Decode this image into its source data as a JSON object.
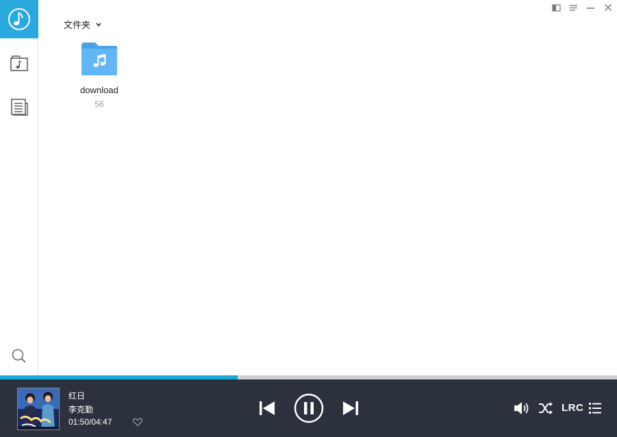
{
  "colors": {
    "accent": "#2aa9e0",
    "progress": "#1ba9d9",
    "player_bg": "#2c323d",
    "folder": "#5fb3f2"
  },
  "header": {
    "folder_dropdown_label": "文件夹"
  },
  "folders": [
    {
      "name": "download",
      "count": "56",
      "icon": "music-folder-icon"
    }
  ],
  "player": {
    "title": "红日",
    "artist": "李克勤",
    "time": "01:50/04:47",
    "progress": 0.385,
    "lrc_label": "LRC"
  }
}
